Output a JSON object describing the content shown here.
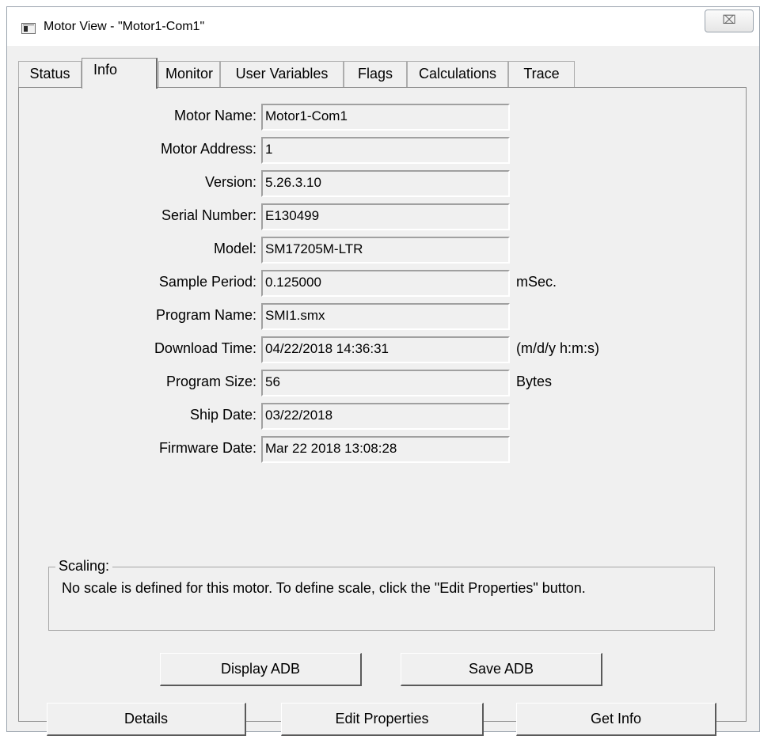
{
  "window": {
    "title": "Motor View - \"Motor1-Com1\"",
    "close_glyph": "⌧"
  },
  "tabs": [
    {
      "label": "Status"
    },
    {
      "label": "Info"
    },
    {
      "label": "Monitor"
    },
    {
      "label": "User Variables"
    },
    {
      "label": "Flags"
    },
    {
      "label": "Calculations"
    },
    {
      "label": "Trace"
    }
  ],
  "active_tab": "Info",
  "info": {
    "fields": [
      {
        "label": "Motor Name:",
        "value": "Motor1-Com1",
        "unit": ""
      },
      {
        "label": "Motor Address:",
        "value": "1",
        "unit": ""
      },
      {
        "label": "Version:",
        "value": "5.26.3.10",
        "unit": ""
      },
      {
        "label": "Serial Number:",
        "value": "E130499",
        "unit": ""
      },
      {
        "label": "Model:",
        "value": "SM17205M-LTR",
        "unit": ""
      },
      {
        "label": "Sample Period:",
        "value": "0.125000",
        "unit": "mSec."
      },
      {
        "label": "Program Name:",
        "value": "SMI1.smx",
        "unit": ""
      },
      {
        "label": "Download Time:",
        "value": "04/22/2018 14:36:31",
        "unit": "(m/d/y h:m:s)"
      },
      {
        "label": "Program Size:",
        "value": "56",
        "unit": "Bytes"
      },
      {
        "label": "Ship Date:",
        "value": "03/22/2018",
        "unit": ""
      },
      {
        "label": "Firmware Date:",
        "value": "Mar 22 2018 13:08:28",
        "unit": ""
      }
    ]
  },
  "scaling": {
    "title": "Scaling:",
    "text": "No scale is defined for this motor. To define scale, click the \"Edit Properties\" button."
  },
  "buttons": {
    "display_adb": "Display ADB",
    "save_adb": "Save ADB",
    "details": "Details",
    "edit_properties": "Edit Properties",
    "get_info": "Get Info"
  },
  "colors": {
    "panel_bg": "#f0f0f0",
    "border": "#8f8f8f"
  }
}
